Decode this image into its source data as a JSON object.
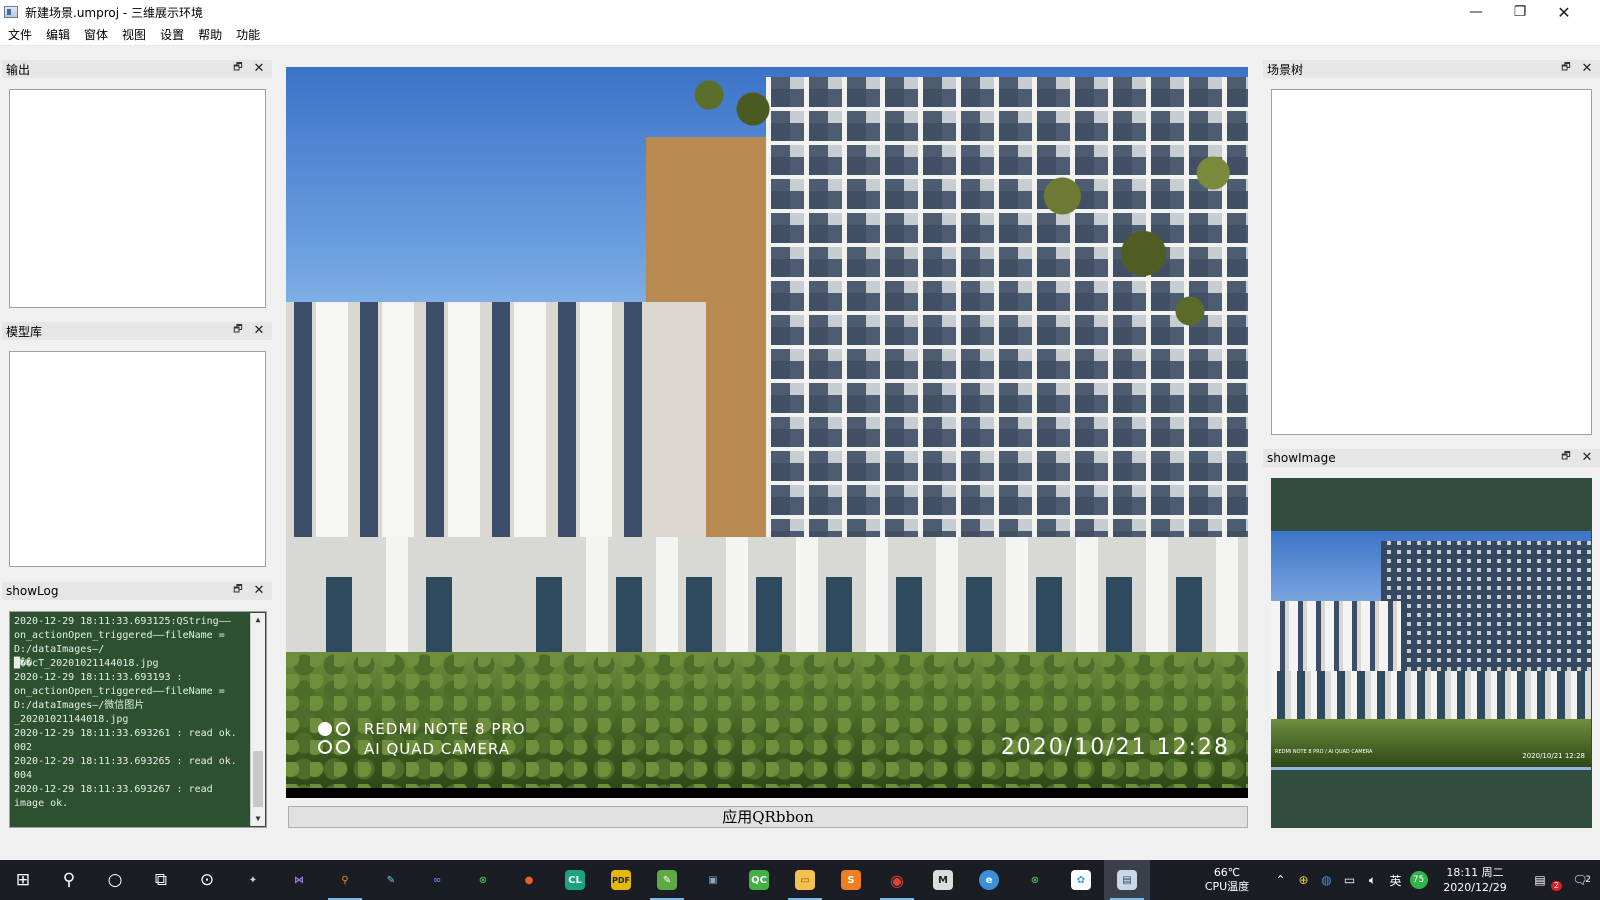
{
  "window": {
    "title": "新建场景.umproj - 三维展示环境",
    "min_glyph": "—",
    "max_glyph": "❐",
    "close_glyph": "✕"
  },
  "menu": [
    "文件",
    "编辑",
    "窗体",
    "视图",
    "设置",
    "帮助",
    "功能"
  ],
  "docks": {
    "output": {
      "title": "输出"
    },
    "model_library": {
      "title": "模型库"
    },
    "show_log": {
      "title": "showLog",
      "lines": [
        "2020-12-29 18:11:33.693125:QString——",
        "on_actionOpen_triggered——fileName =",
        "D:/dataImages—/",
        "█��cT_20201021144018.jpg",
        "2020-12-29 18:11:33.693193 :",
        "on_actionOpen_triggered——fileName =",
        "D:/dataImages—/微信图片",
        "_20201021144018.jpg",
        "2020-12-29 18:11:33.693261 : read ok.",
        "002",
        "2020-12-29 18:11:33.693265 : read ok.",
        "004",
        "2020-12-29 18:11:33.693267 : read",
        "image ok."
      ]
    },
    "scene_tree": {
      "title": "场景树"
    },
    "show_image": {
      "title": "showImage"
    },
    "float_glyph": "🗗",
    "close_glyph": "✕"
  },
  "photo": {
    "watermark_line1": "REDMI NOTE 8 PRO",
    "watermark_line2": "AI QUAD CAMERA",
    "timestamp": "2020/10/21  12:28",
    "thumb_watermark": "REDMI NOTE 8 PRO / AI QUAD CAMERA",
    "thumb_timestamp": "2020/10/21  12:28"
  },
  "apply_button": {
    "label": "应用QRbbon"
  },
  "taskbar": {
    "apps": [
      {
        "icon": "windows-start-icon",
        "glyph": "⊞"
      },
      {
        "icon": "search-icon",
        "glyph": "⚲"
      },
      {
        "icon": "cortana-icon",
        "glyph": "○"
      },
      {
        "icon": "task-view-icon",
        "glyph": "⧉"
      },
      {
        "icon": "magnifier-icon",
        "glyph": "⊙"
      },
      {
        "icon": "bird-app-icon",
        "glyph": "✦",
        "color": "#c9d7e8"
      },
      {
        "icon": "visual-studio-icon",
        "glyph": "⋈",
        "color": "#8a5fd3"
      },
      {
        "icon": "search-tool-icon",
        "glyph": "⚲",
        "color": "#f48b1f"
      },
      {
        "icon": "paint-icon",
        "glyph": "✎",
        "color": "#7fc3e8"
      },
      {
        "icon": "infinity-app-icon",
        "glyph": "∞",
        "color": "#5d7bd8"
      },
      {
        "icon": "xbox-icon",
        "glyph": "⊗",
        "color": "#52a85a"
      },
      {
        "icon": "firefox-icon",
        "glyph": "●",
        "color": "#e8622a"
      },
      {
        "icon": "clion-icon",
        "glyph": "CL",
        "color": "#1aa57d"
      },
      {
        "icon": "pdf-icon",
        "glyph": "PDF",
        "color": "#e5b80c"
      },
      {
        "icon": "notepad-icon",
        "glyph": "✎",
        "color": "#5fa944"
      },
      {
        "icon": "photo-viewer-icon",
        "glyph": "▣",
        "color": "#8aa9c8"
      },
      {
        "icon": "qt-creator-icon",
        "glyph": "QC",
        "color": "#41b046"
      },
      {
        "icon": "file-explorer-icon",
        "glyph": "▭",
        "color": "#f2c14e"
      },
      {
        "icon": "sublime-icon",
        "glyph": "S",
        "color": "#ef7e1e"
      },
      {
        "icon": "chrome-icon",
        "glyph": "◉",
        "color": "#e44134"
      },
      {
        "icon": "monitor-app-icon",
        "glyph": "M",
        "color": "#dddddd"
      },
      {
        "icon": "edge-icon",
        "glyph": "e",
        "color": "#3a8fd8"
      },
      {
        "icon": "xbox-icon-2",
        "glyph": "⊗",
        "color": "#52a85a"
      },
      {
        "icon": "network-app-icon",
        "glyph": "✿",
        "color": "#3aa0e8"
      },
      {
        "icon": "qt-window-icon",
        "glyph": "▤",
        "color": "#c8d8e8"
      }
    ],
    "cpu_temp": "66℃",
    "cpu_label": "CPU温度",
    "ime": "英",
    "perf_badge": "75",
    "time": "18:11 周二",
    "date": "2020/12/29",
    "notification_count": "2",
    "action_center_count": "2"
  }
}
